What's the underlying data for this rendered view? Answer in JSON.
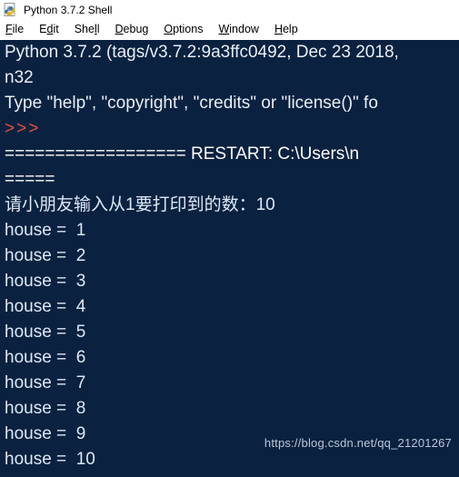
{
  "window": {
    "title": "Python 3.7.2 Shell",
    "icon": "python-icon"
  },
  "menubar": {
    "items": [
      {
        "label": "File",
        "pre": "",
        "acc": "F",
        "post": "ile"
      },
      {
        "label": "Edit",
        "pre": "E",
        "acc": "d",
        "post": "it"
      },
      {
        "label": "Shell",
        "pre": "She",
        "acc": "l",
        "post": "l"
      },
      {
        "label": "Debug",
        "pre": "",
        "acc": "D",
        "post": "ebug"
      },
      {
        "label": "Options",
        "pre": "",
        "acc": "O",
        "post": "ptions"
      },
      {
        "label": "Window",
        "pre": "",
        "acc": "W",
        "post": "indow"
      },
      {
        "label": "Help",
        "pre": "",
        "acc": "H",
        "post": "elp"
      }
    ]
  },
  "console": {
    "background_color": "#0a2240",
    "output_color": "#dce8f5",
    "prompt_color": "#e8503a",
    "lines": [
      {
        "kind": "sys",
        "text": "Python 3.7.2 (tags/v3.7.2:9a3ffc0492, Dec 23 2018,"
      },
      {
        "kind": "sys",
        "text": "n32"
      },
      {
        "kind": "sys",
        "text": "Type \"help\", \"copyright\", \"credits\" or \"license()\" fo"
      },
      {
        "kind": "prompt",
        "text": ">>>"
      },
      {
        "kind": "restart",
        "text": "================== RESTART: C:\\Users\\n"
      },
      {
        "kind": "restart",
        "text": "====="
      },
      {
        "kind": "out",
        "text": "请小朋友输入从1要打印到的数：",
        "input": "10"
      },
      {
        "kind": "out",
        "text": "house =  1"
      },
      {
        "kind": "out",
        "text": "house =  2"
      },
      {
        "kind": "out",
        "text": "house =  3"
      },
      {
        "kind": "out",
        "text": "house =  4"
      },
      {
        "kind": "out",
        "text": "house =  5"
      },
      {
        "kind": "out",
        "text": "house =  6"
      },
      {
        "kind": "out",
        "text": "house =  7"
      },
      {
        "kind": "out",
        "text": "house =  8"
      },
      {
        "kind": "out",
        "text": "house =  9"
      },
      {
        "kind": "out",
        "text": "house =  10"
      }
    ]
  },
  "watermark": {
    "text": "https://blog.csdn.net/qq_21201267"
  }
}
